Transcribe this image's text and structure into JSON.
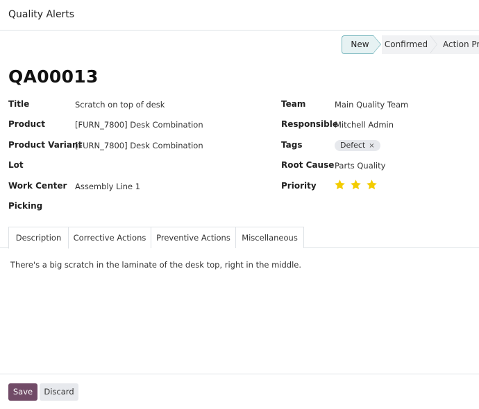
{
  "header": {
    "title": "Quality Alerts"
  },
  "statusbar": {
    "stages": [
      "New",
      "Confirmed",
      "Action Pro"
    ],
    "active": "New"
  },
  "record": {
    "name": "QA00013"
  },
  "left_fields": [
    {
      "label": "Title",
      "value": "Scratch on top of desk"
    },
    {
      "label": "Product",
      "value": "[FURN_7800] Desk Combination"
    },
    {
      "label": "Product Variant",
      "value": "[FURN_7800] Desk Combination"
    },
    {
      "label": "Lot",
      "value": ""
    },
    {
      "label": "Work Center",
      "value": "Assembly Line 1"
    },
    {
      "label": "Picking",
      "value": ""
    }
  ],
  "right_fields": [
    {
      "label": "Team",
      "value": "Main Quality Team"
    },
    {
      "label": "Responsible",
      "value": "Mitchell Admin"
    },
    {
      "label": "Tags",
      "tag": "Defect",
      "tag_remove": "×"
    },
    {
      "label": "Root Cause",
      "value": "Parts Quality"
    },
    {
      "label": "Priority",
      "stars": 3,
      "max_stars": 3
    }
  ],
  "tabs": [
    "Description",
    "Corrective Actions",
    "Preventive Actions",
    "Miscellaneous"
  ],
  "active_tab": "Description",
  "description": "There's a big scratch in the laminate of the desk top, right in the middle.",
  "buttons": {
    "save": "Save",
    "discard": "Discard"
  },
  "colors": {
    "primary": "#714b67",
    "star": "#f3cc00",
    "stage_active": "#e6f2f3"
  },
  "icons": {
    "star": "star-icon",
    "remove": "close-icon"
  }
}
